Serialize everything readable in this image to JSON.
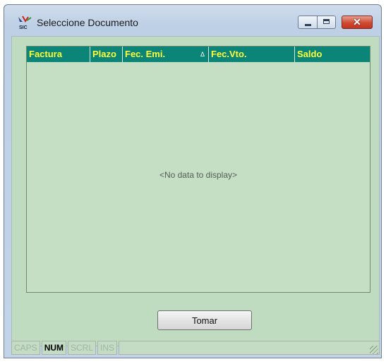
{
  "window": {
    "title": "Seleccione Documento",
    "title_icon": "app-logo-icon",
    "controls": {
      "minimize": "minimize-icon",
      "maximize": "maximize-icon",
      "close": "✕"
    }
  },
  "grid": {
    "columns": [
      {
        "label": "Factura"
      },
      {
        "label": "Plazo"
      },
      {
        "label": "Fec. Emi.",
        "sort": "Δ"
      },
      {
        "label": "Fec.Vto."
      },
      {
        "label": "Saldo"
      }
    ],
    "empty_message": "<No data to display>"
  },
  "buttons": {
    "take": "Tomar"
  },
  "statusbar": {
    "panels": [
      {
        "label": "CAPS",
        "active": false
      },
      {
        "label": "NUM",
        "active": true
      },
      {
        "label": "SCRL",
        "active": false
      },
      {
        "label": "INS",
        "active": false
      }
    ]
  },
  "colors": {
    "header_bg": "#0a8577",
    "header_text": "#ffff3a",
    "grid_bg": "#c5dfc5"
  }
}
